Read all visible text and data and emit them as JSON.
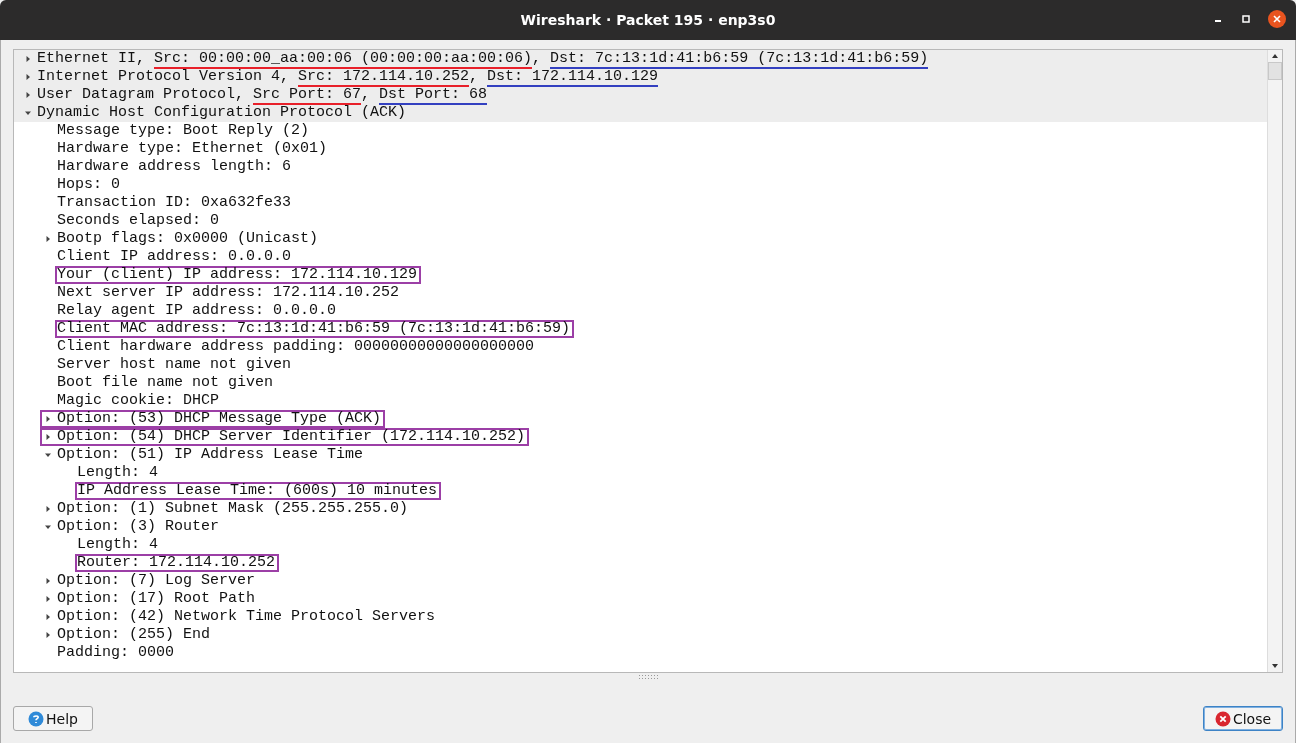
{
  "window": {
    "title": "Wireshark · Packet 195 · enp3s0"
  },
  "tree": [
    {
      "parts": [
        {
          "text": "Ethernet II, "
        },
        {
          "text": "Src: 00:00:00_aa:00:06 (00:00:00:aa:00:06)",
          "color": "#e8202a"
        },
        {
          "text": ", "
        },
        {
          "text": "Dst: 7c:13:1d:41:b6:59 (7c:13:1d:41:b6:59)",
          "color": "#3340c0"
        }
      ],
      "expanded": false,
      "boxed": false
    },
    {
      "parts": [
        {
          "text": "Internet Protocol Version 4, "
        },
        {
          "text": "Src: 172.114.10.252",
          "color": "#e8202a"
        },
        {
          "text": ", "
        },
        {
          "text": "Dst: 172.114.10.129",
          "color": "#3340c0"
        }
      ],
      "expanded": false,
      "boxed": false
    },
    {
      "parts": [
        {
          "text": "User Datagram Protocol, "
        },
        {
          "text": "Src Port: 67",
          "color": "#e8202a"
        },
        {
          "text": ", "
        },
        {
          "text": "Dst Port: 68",
          "color": "#3340c0"
        }
      ],
      "expanded": false,
      "boxed": false
    },
    {
      "parts": [
        {
          "text": "Dynamic Host Configuration Protocol (ACK)"
        }
      ],
      "expanded": true,
      "boxed": false,
      "children": [
        {
          "parts": [
            {
              "text": "Message type: Boot Reply (2)"
            }
          ],
          "boxed": false
        },
        {
          "parts": [
            {
              "text": "Hardware type: Ethernet (0x01)"
            }
          ],
          "boxed": false
        },
        {
          "parts": [
            {
              "text": "Hardware address length: 6"
            }
          ],
          "boxed": false
        },
        {
          "parts": [
            {
              "text": "Hops: 0"
            }
          ],
          "boxed": false
        },
        {
          "parts": [
            {
              "text": "Transaction ID: 0xa632fe33"
            }
          ],
          "boxed": false
        },
        {
          "parts": [
            {
              "text": "Seconds elapsed: 0"
            }
          ],
          "boxed": false
        },
        {
          "parts": [
            {
              "text": "Bootp flags: 0x0000 (Unicast)"
            }
          ],
          "expanded": false,
          "boxed": false
        },
        {
          "parts": [
            {
              "text": "Client IP address: 0.0.0.0"
            }
          ],
          "boxed": false
        },
        {
          "parts": [
            {
              "text": "Your (client) IP address: 172.114.10.129"
            }
          ],
          "boxed": true
        },
        {
          "parts": [
            {
              "text": "Next server IP address: 172.114.10.252"
            }
          ],
          "boxed": false
        },
        {
          "parts": [
            {
              "text": "Relay agent IP address: 0.0.0.0"
            }
          ],
          "boxed": false
        },
        {
          "parts": [
            {
              "text": "Client MAC address: 7c:13:1d:41:b6:59 (7c:13:1d:41:b6:59)"
            }
          ],
          "boxed": true
        },
        {
          "parts": [
            {
              "text": "Client hardware address padding: 00000000000000000000"
            }
          ],
          "boxed": false
        },
        {
          "parts": [
            {
              "text": "Server host name not given"
            }
          ],
          "boxed": false
        },
        {
          "parts": [
            {
              "text": "Boot file name not given"
            }
          ],
          "boxed": false
        },
        {
          "parts": [
            {
              "text": "Magic cookie: DHCP"
            }
          ],
          "boxed": false
        },
        {
          "parts": [
            {
              "text": "Option: (53) DHCP Message Type (ACK)"
            }
          ],
          "expanded": false,
          "boxed": true
        },
        {
          "parts": [
            {
              "text": "Option: (54) DHCP Server Identifier (172.114.10.252)"
            }
          ],
          "expanded": false,
          "boxed": true
        },
        {
          "parts": [
            {
              "text": "Option: (51) IP Address Lease Time"
            }
          ],
          "expanded": true,
          "boxed": false,
          "children": [
            {
              "parts": [
                {
                  "text": "Length: 4"
                }
              ],
              "boxed": false
            },
            {
              "parts": [
                {
                  "text": "IP Address Lease Time: (600s) 10 minutes"
                }
              ],
              "boxed": true
            }
          ]
        },
        {
          "parts": [
            {
              "text": "Option: (1) Subnet Mask (255.255.255.0)"
            }
          ],
          "expanded": false,
          "boxed": false
        },
        {
          "parts": [
            {
              "text": "Option: (3) Router"
            }
          ],
          "expanded": true,
          "boxed": false,
          "children": [
            {
              "parts": [
                {
                  "text": "Length: 4"
                }
              ],
              "boxed": false
            },
            {
              "parts": [
                {
                  "text": "Router: 172.114.10.252"
                }
              ],
              "boxed": true
            }
          ]
        },
        {
          "parts": [
            {
              "text": "Option: (7) Log Server"
            }
          ],
          "expanded": false,
          "boxed": false
        },
        {
          "parts": [
            {
              "text": "Option: (17) Root Path"
            }
          ],
          "expanded": false,
          "boxed": false
        },
        {
          "parts": [
            {
              "text": "Option: (42) Network Time Protocol Servers"
            }
          ],
          "expanded": false,
          "boxed": false
        },
        {
          "parts": [
            {
              "text": "Option: (255) End"
            }
          ],
          "expanded": false,
          "boxed": false
        },
        {
          "parts": [
            {
              "text": "Padding: 0000"
            }
          ],
          "boxed": false
        }
      ]
    }
  ],
  "buttons": [
    {
      "label": "Help",
      "kind": "help",
      "focused": false
    },
    {
      "label": "Close",
      "kind": "close",
      "focused": true
    }
  ]
}
